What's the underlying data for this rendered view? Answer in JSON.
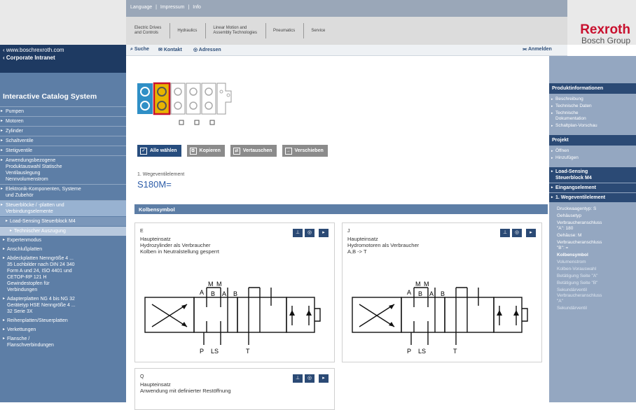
{
  "header": {
    "toplinks": [
      "Language",
      "|",
      "Impressum",
      "|",
      "Info"
    ],
    "tabs": [
      "Electric Drives\nand Controls",
      "Hydraulics",
      "Linear Motion and\nAssembly Technologies",
      "Pneumatics",
      "Service"
    ],
    "brand": "Rexroth",
    "brand_sub": "Bosch Group"
  },
  "left_top": {
    "site_link": "‹ www.boschrexroth.com",
    "intranet_link": "‹ Corporate Intranet"
  },
  "left_nav": {
    "title": "Interactive Catalog System",
    "items": [
      "Pumpen",
      "Motoren",
      "Zylinder",
      "Schaltventile",
      "Stetigventile",
      "Anwendungsbezogene\nProduktauswahl Statische\nVentilauslegung\nNennvolumenstrom",
      "Elektronik-Komponenten, Systeme\nund Zubehör",
      "Steuerblöcke / -platten und\nVerbindungselemente"
    ],
    "sub_active": "Load-Sensing Steuerblock M4",
    "sub_sub_active": "Technischer Auszugung",
    "sub_sub": "Expertenmodus",
    "more": [
      "Anschlußplatten",
      "Abdeckplatten Nenngröße 4 ...\n35 Lochbilder nach DIN 24 340\nForm A und 24, ISO 4401 und\nCETOP-RP 121 H\nGewindestopfen für\nVerbindungen",
      "Adapterplatten NG 4 bis NG 32\nGerätetyp HSE Nenngröße 4 ...\n32 Serie 3X",
      "Reihenplatten/Steuerplatten",
      "Verkettungen",
      "Flansche /\nFlanschverbindungen"
    ]
  },
  "toolbar": {
    "search": "Suche",
    "contact": "Kontakt",
    "address": "Adressen",
    "login": "Anmelden"
  },
  "actions": {
    "select_all": "Alle wählen",
    "copy": "Kopieren",
    "swap": "Vertauschen",
    "move": "Verschieben"
  },
  "element": {
    "title": "1. Wegeventilelement",
    "code": "S180M="
  },
  "section": {
    "title": "Kolbensymbol"
  },
  "cards": [
    {
      "letter": "E",
      "line1": "Haupteinsatz",
      "line2": "Hydrozylinder als Verbraucher",
      "line3": "Kolben in Neutralstellung gesperrt"
    },
    {
      "letter": "J",
      "line1": "Haupteinsatz",
      "line2": "Hydromotoren als Verbraucher",
      "line3": "A,B -> T"
    },
    {
      "letter": "Q",
      "line1": "Haupteinsatz",
      "line2": "Anwendung mit definierter Restöffnung",
      "line3": ""
    }
  ],
  "diagram_labels": {
    "m": "M",
    "a": "A",
    "b": "B",
    "p": "P",
    "ls": "LS",
    "t": "T"
  },
  "right_nav": {
    "produkt_title": "Produktinformationen",
    "produkt_items": [
      "Beschreibung",
      "Technische Daten",
      "Technische\nDokumentation",
      "Schaltplan-Vorschau"
    ],
    "projekt_title": "Projekt",
    "projekt_items": [
      "Öffnen",
      "Hinzufügen"
    ],
    "blocks": [
      "Load-Sensing\nSteuerblock M4",
      "Eingangselement",
      "1. Wegeventilelement"
    ],
    "values": [
      "Druckwaagentyp: S",
      "Gehäusetyp",
      "Verbraucheranschluss\n\"A\": 180",
      "Gehäuse: M",
      "Verbraucheranschluss\n\"B\": =",
      "Kolbensymbol",
      "Volumenstrom",
      "Kolben-Vorauswahl",
      "Betätigung Seite \"A\"",
      "Betätigung Seite \"B\"",
      "Sekundärventil\nVerbraucheranschluss\n\"A\"",
      "Sekundärventil"
    ]
  },
  "colors": {
    "nav_dark": "#1e3a62",
    "nav_mid": "#5d7ea6",
    "right_nav": "#94a7c1",
    "button_gray": "#8b8b8b",
    "accent_red": "#c8102e",
    "highlight_yellow": "#e8b400"
  },
  "icons": {
    "search": "magnifier-icon",
    "contact": "envelope-icon",
    "address": "globe-icon",
    "login": "key-icon",
    "card_icons": [
      "symbol-icon",
      "info-icon",
      "select-icon"
    ]
  }
}
